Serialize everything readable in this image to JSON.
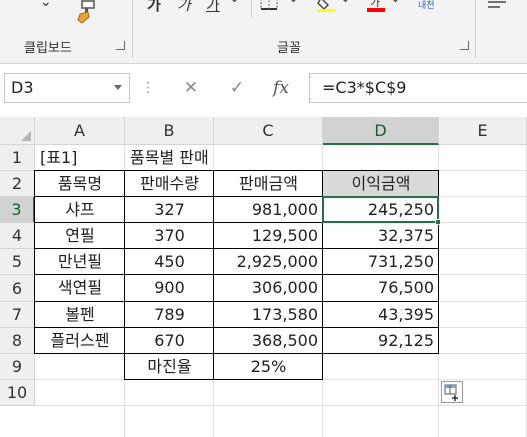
{
  "ribbon": {
    "group_clipboard": "클립보드",
    "group_font": "글꼴",
    "bold_glyph": "가",
    "italic_glyph": "가",
    "underline_glyph": "가",
    "underline_arrow": "⌄",
    "fill_color": "#ffff00",
    "font_color": "#ff0000",
    "small_label": "내천",
    "brush_icon": "format-painter-icon"
  },
  "formula_bar": {
    "name_box": "D3",
    "formula": "=C3*$C$9",
    "cancel_glyph": "✕",
    "enter_glyph": "✓",
    "fx_glyph": "fx"
  },
  "sheet": {
    "columns": [
      "A",
      "B",
      "C",
      "D",
      "E"
    ],
    "rows": [
      "1",
      "2",
      "3",
      "4",
      "5",
      "6",
      "7",
      "8",
      "9",
      "10"
    ],
    "selected_cell": "D3",
    "title_a1": "[표1]",
    "title_b1": "품목별 판매 현황",
    "headers": [
      "품목명",
      "판매수량",
      "판매금액",
      "이익금액"
    ],
    "header_fill_d2": "#d9d9d9",
    "data": [
      [
        "샤프",
        "327",
        "981,000",
        "245,250"
      ],
      [
        "연필",
        "370",
        "129,500",
        "32,375"
      ],
      [
        "만년필",
        "450",
        "2,925,000",
        "731,250"
      ],
      [
        "색연필",
        "900",
        "306,000",
        "76,500"
      ],
      [
        "볼펜",
        "789",
        "173,580",
        "43,395"
      ],
      [
        "플러스펜",
        "670",
        "368,500",
        "92,125"
      ]
    ],
    "margin_label": "마진율",
    "margin_value": "25%"
  },
  "accent": "#217346"
}
